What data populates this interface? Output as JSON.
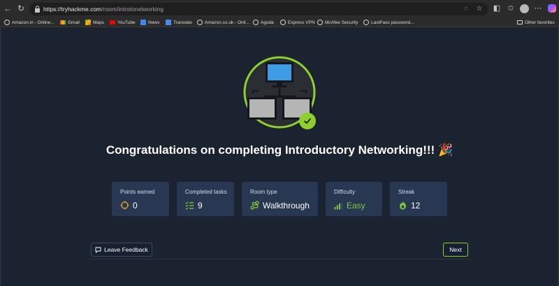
{
  "browser": {
    "url_host": "https://tryhackme.com",
    "url_path": "/room/introtonetworking",
    "bookmarks": [
      {
        "label": "Amazon.in - Online...",
        "icon": "globe-icon"
      },
      {
        "label": "Gmail",
        "icon": "gmail-icon"
      },
      {
        "label": "Maps",
        "icon": "maps-icon"
      },
      {
        "label": "YouTube",
        "icon": "youtube-icon"
      },
      {
        "label": "News",
        "icon": "news-icon"
      },
      {
        "label": "Translate",
        "icon": "translate-icon"
      },
      {
        "label": "Amazon.co.uk - Onli...",
        "icon": "globe-icon"
      },
      {
        "label": "Agoda",
        "icon": "globe-icon"
      },
      {
        "label": "Express VPN",
        "icon": "globe-icon"
      },
      {
        "label": "McAfee Security",
        "icon": "globe-icon"
      },
      {
        "label": "LastPass password...",
        "icon": "globe-icon"
      }
    ],
    "other_favorites": "Other favorites"
  },
  "completion": {
    "headline": "Congratulations on completing Introductory Networking!!!",
    "party_emoji": "🎉",
    "badge_icon": "network-computers-icon",
    "accent_color": "#8fd12c"
  },
  "stats": [
    {
      "label": "Points earned",
      "value": "0",
      "icon": "target-icon"
    },
    {
      "label": "Completed tasks",
      "value": "9",
      "icon": "checklist-icon"
    },
    {
      "label": "Room type",
      "value": "Walkthrough",
      "icon": "route-icon"
    },
    {
      "label": "Difficulty",
      "value": "Easy",
      "icon": "signal-bars-icon"
    },
    {
      "label": "Streak",
      "value": "12",
      "icon": "flame-icon"
    }
  ],
  "actions": {
    "feedback_label": "Leave Feedback",
    "next_label": "Next"
  }
}
